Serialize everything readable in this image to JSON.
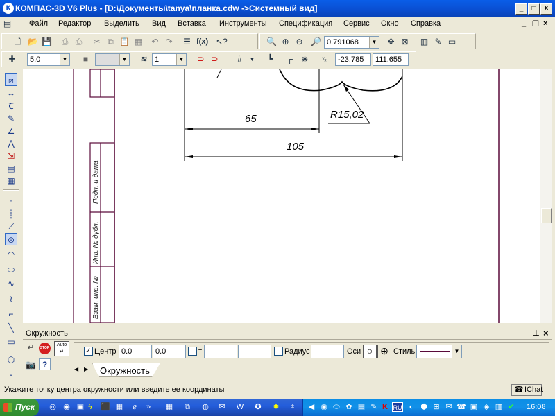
{
  "window": {
    "title": "КОМПАС-3D V6 Plus - [D:\\Документы\\tanya\\планка.cdw ->Системный вид]",
    "controls": {
      "minimize": "_",
      "maximize": "□",
      "close": "X"
    },
    "inner_controls": {
      "minimize": "_",
      "restore": "❐",
      "close": "×"
    }
  },
  "menu": {
    "items": [
      "Файл",
      "Редактор",
      "Выделить",
      "Вид",
      "Вставка",
      "Инструменты",
      "Спецификация",
      "Сервис",
      "Окно",
      "Справка"
    ]
  },
  "toolbar1": {
    "zoom_value": "0.791068"
  },
  "toolbar2": {
    "step_value": "5.0",
    "layer_value": "1",
    "coord_x": "-23.785",
    "coord_y": "111.655"
  },
  "drawing": {
    "dim1": "65",
    "dim2": "105",
    "radius_label": "R15,02",
    "stamp1": "Подп. и дата",
    "stamp2": "Инв. № дубл.",
    "stamp3": "Взам. инв. №"
  },
  "panel": {
    "title": "Окружность",
    "pin": "⊥",
    "close": "×",
    "stop_label": "STOP",
    "auto_label": "Auto",
    "center_label": "Центр",
    "center_x": "0.0",
    "center_y": "0.0",
    "t_label": "т",
    "radius_label": "Радиус",
    "axes_label": "Оси",
    "style_label": "Стиль",
    "tab_label": "Окружность"
  },
  "status": {
    "text": "Укажите точку центра окружности или введите ее координаты",
    "chat_label": "IChat"
  },
  "taskbar": {
    "start_label": "Пуск",
    "lang": "RU",
    "clock": "16:08"
  },
  "colors": {
    "titlebar": "#0a4fd2",
    "frame_line": "#5a0a3a",
    "taskbar": "#245edb"
  }
}
